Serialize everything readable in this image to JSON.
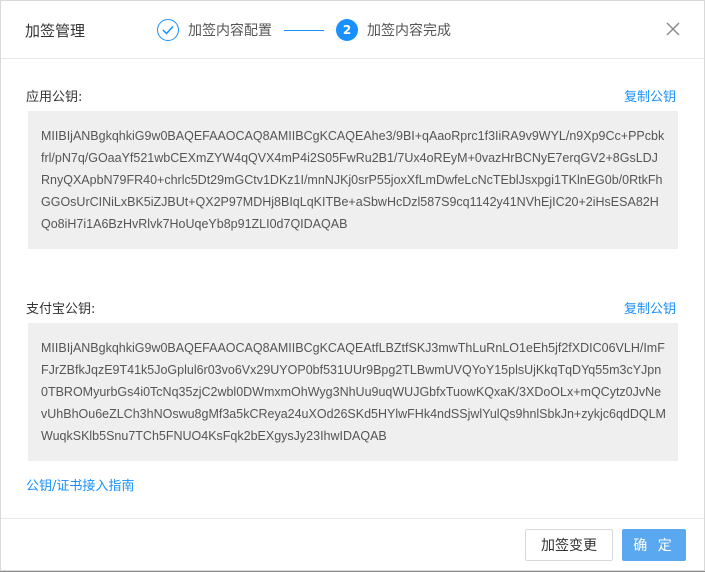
{
  "dialog": {
    "title": "加签管理",
    "steps": [
      {
        "label": "加签内容配置",
        "state": "done"
      },
      {
        "number": "2",
        "label": "加签内容完成",
        "state": "active"
      }
    ],
    "close_icon": "close-icon"
  },
  "app_public_key": {
    "label": "应用公钥:",
    "copy_label": "复制公钥",
    "value": "MIIBIjANBgkqhkiG9w0BAQEFAAOCAQ8AMIIBCgKCAQEAhe3/9BI+qAaoRprc1f3IiRA9v9WYL/n9Xp9Cc+PPcbkfrl/pN7q/GOaaYf521wbCEXmZYW4qQVX4mP4i2S05FwRu2B1/7Ux4oREyM+0vazHrBCNyE7erqGV2+8GsLDJRnyQXApbN79FR40+chrlc5Dt29mGCtv1DKz1I/mnNJKj0srP55joxXfLmDwfeLcNcTEblJsxpgi1TKlnEG0b/0RtkFhGGOsUrCINiLxBK5iZJBUt+QX2P97MDHj8BIqLqKITBe+aSbwHcDzl587S9cq1142y41NVhEjIC20+2iHsESA82HQo8iH7i1A6BzHvRlvk7HoUqeYb8p91ZLI0d7QIDAQAB"
  },
  "alipay_public_key": {
    "label": "支付宝公钥:",
    "copy_label": "复制公钥",
    "value": "MIIBIjANBgkqhkiG9w0BAQEFAAOCAQ8AMIIBCgKCAQEAtfLBZtfSKJ3mwThLuRnLO1eEh5jf2fXDIC06VLH/ImFFJrZBfkJqzE9T41k5JoGplul6r03vo6Vx29UYOP0bf531UUr9Bpg2TLBwmUVQYoY15plsUjKkqTqDYq55m3cYJpn0TBROMyurbGs4i0TcNq35zjC2wbl0DWmxmOhWyg3NhUu9uqWUJGbfxTuowKQxaK/3XDoOLx+mQCytz0JvNevUhBhOu6eZLCh3hNOswu8gMf3a5kCReya24uXOd26SKd5HYlwFHk4ndSSjwlYulQs9hnlSbkJn+zykjc6qdDQLMWuqkSKlb5Snu7TCh5FNUO4KsFqk2bEXgysJy23IhwIDAQAB"
  },
  "guide_link": "公钥/证书接入指南",
  "footer": {
    "change_label": "加签变更",
    "confirm_label": "确 定"
  }
}
